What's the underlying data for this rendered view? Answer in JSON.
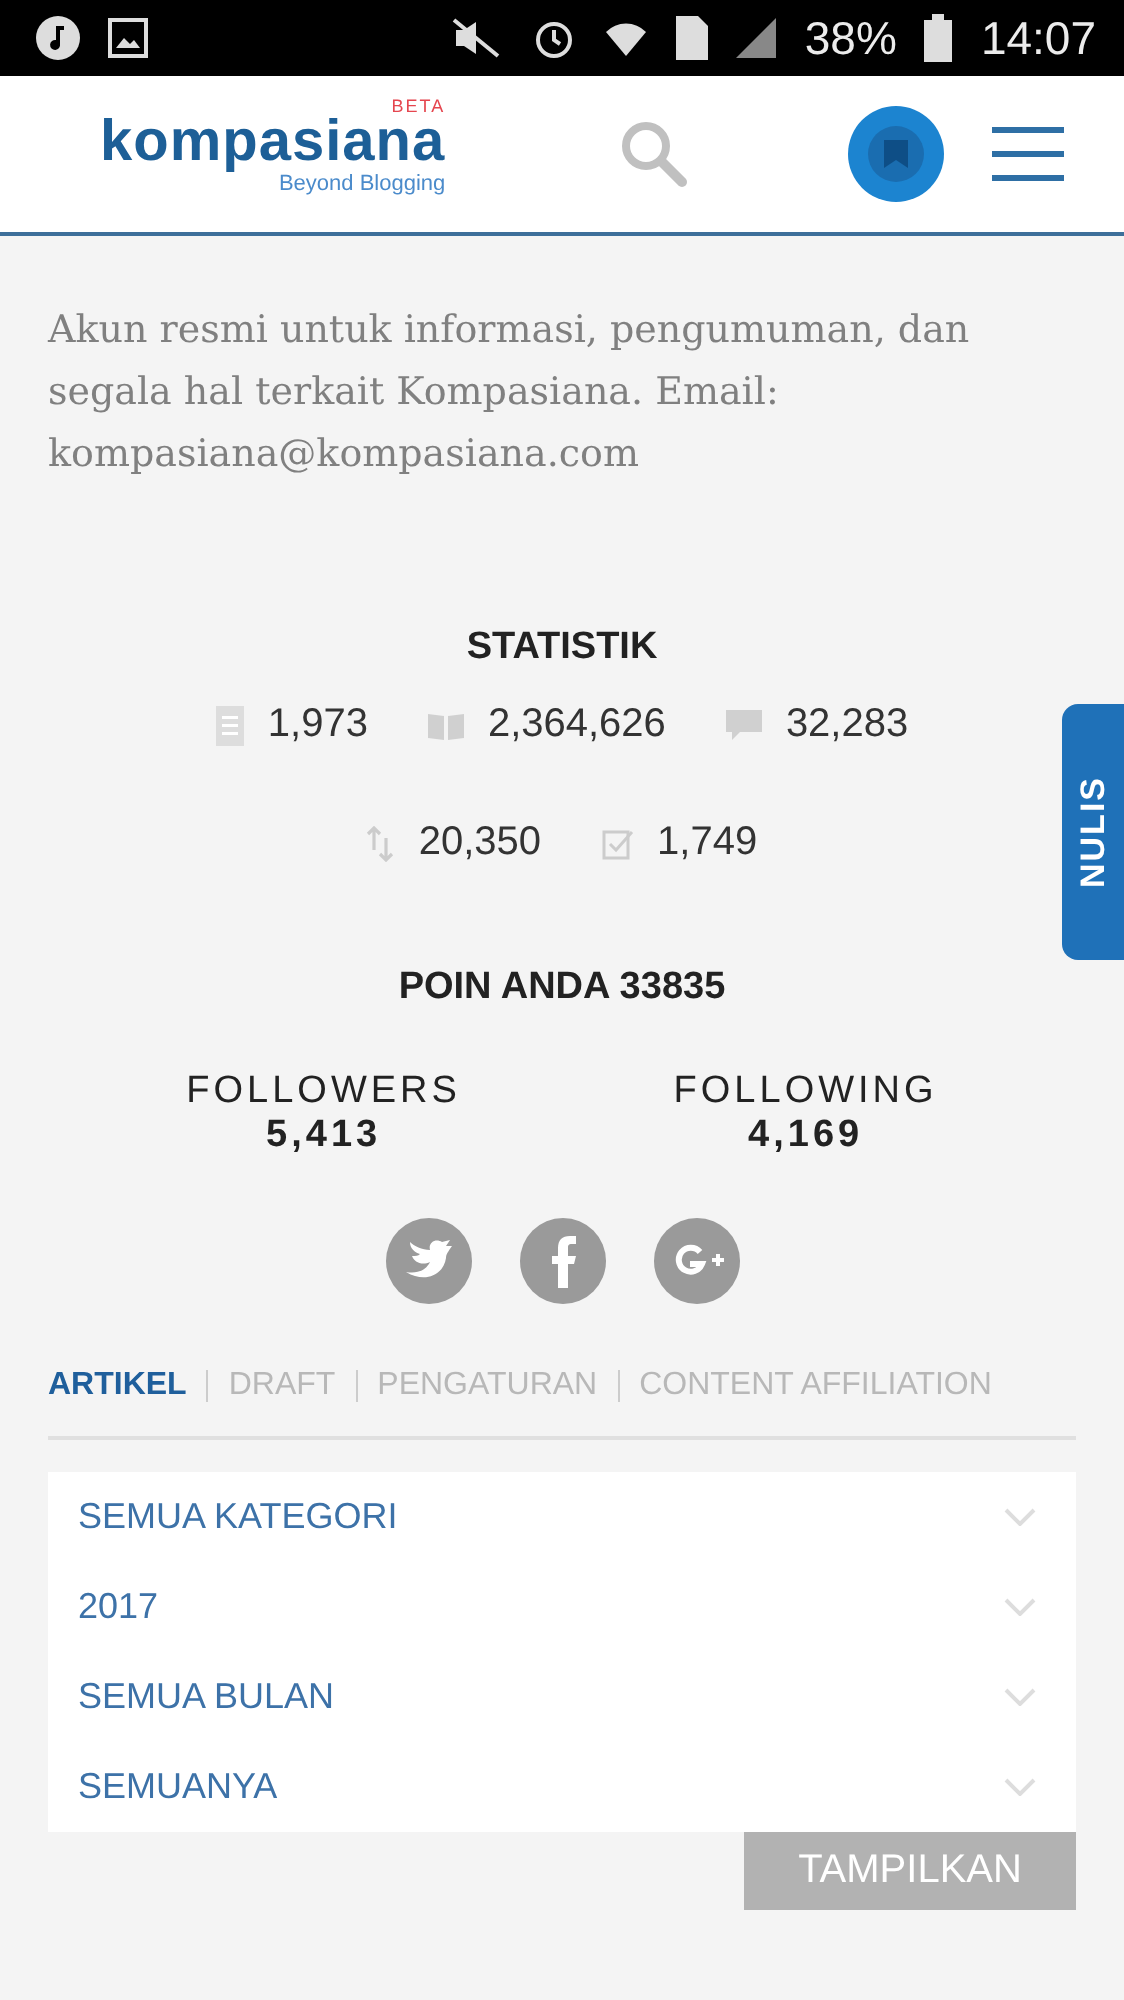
{
  "status_bar": {
    "battery": "38%",
    "time": "14:07"
  },
  "header": {
    "logo": "kompasiana",
    "logo_badge": "BETA",
    "tagline": "Beyond Blogging"
  },
  "description": "Akun resmi untuk informasi, pengumuman, dan segala hal terkait Kompasiana. Email: kompasiana@kompasiana.com",
  "side_tab": "NULIS",
  "statistics": {
    "title": "STATISTIK",
    "rows": [
      [
        {
          "kind": "articles",
          "value": "1,973"
        },
        {
          "kind": "reads",
          "value": "2,364,626"
        },
        {
          "kind": "comments",
          "value": "32,283"
        }
      ],
      [
        {
          "kind": "ratings",
          "value": "20,350"
        },
        {
          "kind": "checked",
          "value": "1,749"
        }
      ]
    ]
  },
  "points": "POIN ANDA 33835",
  "follow": [
    {
      "label": "FOLLOWERS",
      "value": "5,413"
    },
    {
      "label": "FOLLOWING",
      "value": "4,169"
    }
  ],
  "social": [
    {
      "kind": "twitter"
    },
    {
      "kind": "facebook"
    },
    {
      "kind": "googleplus"
    }
  ],
  "tabs": [
    {
      "label": "ARTIKEL",
      "selected": true
    },
    {
      "label": "DRAFT",
      "selected": false
    },
    {
      "label": "PENGATURAN",
      "selected": false
    },
    {
      "label": "CONTENT AFFILIATION",
      "selected": false
    }
  ],
  "filters": [
    {
      "value": "SEMUA KATEGORI"
    },
    {
      "value": "2017"
    },
    {
      "value": "SEMUA BULAN"
    },
    {
      "value": "SEMUANYA"
    }
  ],
  "button": "TAMPILKAN"
}
